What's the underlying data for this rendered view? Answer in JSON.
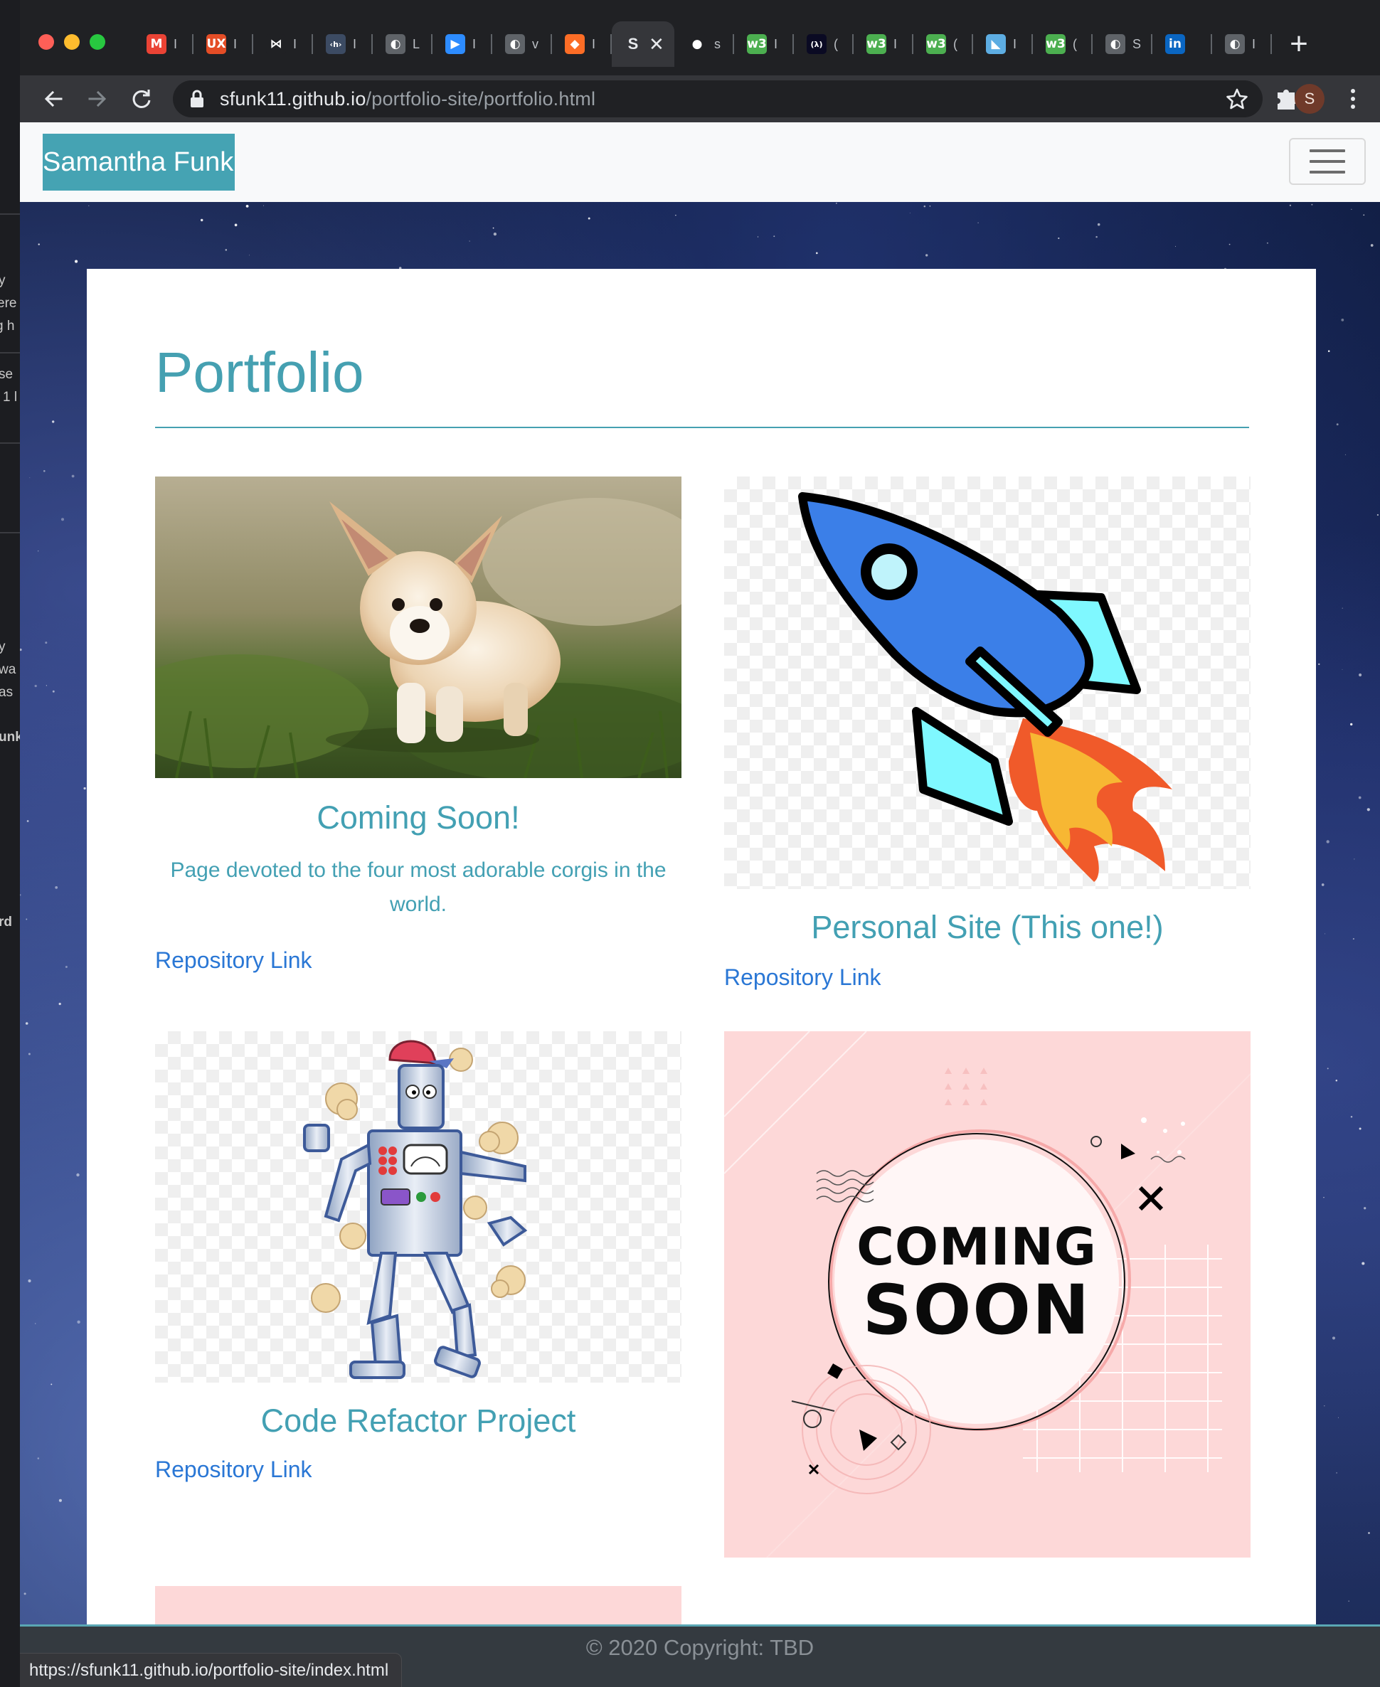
{
  "desktop": {
    "fragments": [
      "y",
      "ere",
      "g h",
      "se",
      "1 l",
      "y",
      "wa",
      "as",
      "unk",
      "rd"
    ]
  },
  "browser": {
    "tabs": [
      {
        "icon": "gmail-icon",
        "favicon_text": "M",
        "color": "#ea4335",
        "tail": "I"
      },
      {
        "icon": "ux-icon",
        "favicon_text": "UX",
        "color": "#e44d26",
        "tail": "I"
      },
      {
        "icon": "bowtie-icon",
        "favicon_text": "⋈",
        "color": "#202124",
        "tail": "I"
      },
      {
        "icon": "code-icon",
        "favicon_text": "‹h›",
        "color": "#3c4b63",
        "tail": "I"
      },
      {
        "icon": "globe-icon",
        "favicon_text": "◐",
        "color": "#5f6368",
        "tail": "L"
      },
      {
        "icon": "zoom-icon",
        "favicon_text": "▶",
        "color": "#2d8cff",
        "tail": "I"
      },
      {
        "icon": "globe-icon",
        "favicon_text": "◐",
        "color": "#5f6368",
        "tail": "v"
      },
      {
        "icon": "gitlab-icon",
        "favicon_text": "◆",
        "color": "#fc6d26",
        "tail": "I"
      },
      {
        "icon": "site-icon",
        "favicon_text": "S",
        "color": "#202124",
        "tail": "",
        "active": true
      },
      {
        "icon": "github-icon",
        "favicon_text": "●",
        "color": "#202124",
        "tail": "s"
      },
      {
        "icon": "w3-icon",
        "favicon_text": "w3",
        "color": "#4caf50",
        "tail": "I"
      },
      {
        "icon": "lambda-icon",
        "favicon_text": "(λ)",
        "color": "#0a0a23",
        "tail": "("
      },
      {
        "icon": "w3-icon",
        "favicon_text": "w3",
        "color": "#4caf50",
        "tail": "I"
      },
      {
        "icon": "w3-icon",
        "favicon_text": "w3",
        "color": "#4caf50",
        "tail": "("
      },
      {
        "icon": "edx-icon",
        "favicon_text": "◣",
        "color": "#5dade2",
        "tail": "I"
      },
      {
        "icon": "w3-icon",
        "favicon_text": "w3",
        "color": "#4caf50",
        "tail": "("
      },
      {
        "icon": "globe-icon",
        "favicon_text": "◐",
        "color": "#5f6368",
        "tail": "S"
      },
      {
        "icon": "linkedin-icon",
        "favicon_text": "in",
        "color": "#0a66c2",
        "tail": ""
      },
      {
        "icon": "globe-icon",
        "favicon_text": "◐",
        "color": "#5f6368",
        "tail": "I"
      }
    ],
    "active_tab_label": "S",
    "url_host": "sfunk11.github.io",
    "url_path": "/portfolio-site/portfolio.html",
    "profile_initial": "S",
    "status_url": "https://sfunk11.github.io/portfolio-site/index.html"
  },
  "page": {
    "brand": "Samantha Funk",
    "title": "Portfolio",
    "items": [
      {
        "title": "Coming Soon!",
        "description": "Page devoted to the four most adorable corgis in the world.",
        "link": "Repository Link",
        "image": "corgi-puppy"
      },
      {
        "title": "Personal Site (This one!)",
        "link": "Repository Link",
        "image": "rocket"
      },
      {
        "title": "Code Refactor Project",
        "link": "Repository Link",
        "image": "robot"
      },
      {
        "image": "coming-soon",
        "coming_soon_top": "COMING",
        "coming_soon_bottom": "SOON"
      }
    ],
    "footer": "© 2020 Copyright: TBD"
  },
  "colors": {
    "accent": "#45a0b1",
    "link": "#2a77d5",
    "navbar_bg": "#f8f9fa",
    "footer_bg": "#343a40"
  }
}
